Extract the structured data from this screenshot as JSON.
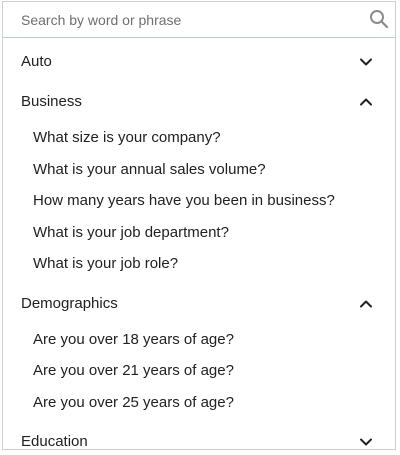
{
  "search": {
    "placeholder": "Search by word or phrase",
    "value": "",
    "icon": "search-icon"
  },
  "groups": [
    {
      "label": "Auto",
      "expanded": false,
      "items": []
    },
    {
      "label": "Business",
      "expanded": true,
      "items": [
        "What size is your company?",
        "What is your annual sales volume?",
        "How many years have you been in business?",
        "What is your job department?",
        "What is your job role?"
      ]
    },
    {
      "label": "Demographics",
      "expanded": true,
      "items": [
        "Are you over 18 years of age?",
        "Are you over 21 years of age?",
        "Are you over 25 years of age?"
      ]
    },
    {
      "label": "Education",
      "expanded": false,
      "items": []
    }
  ],
  "colors": {
    "text": "#212121",
    "icon": "#212121",
    "search_icon": "#8a8a8a",
    "border": "#cfcfcf",
    "search_underline": "#b8cde0"
  }
}
